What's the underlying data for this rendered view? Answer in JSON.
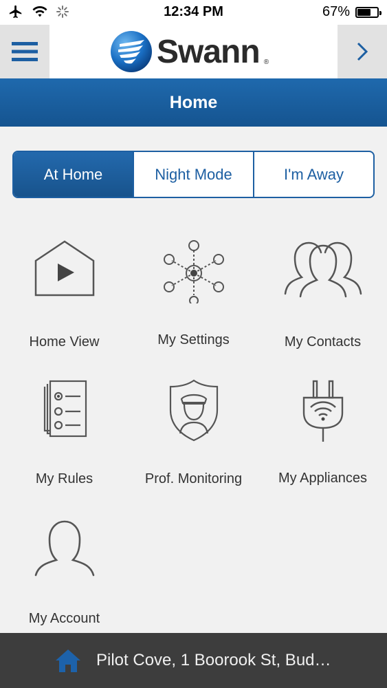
{
  "status_bar": {
    "time": "12:34 PM",
    "battery_percent": "67%",
    "battery_level": 0.67,
    "icons": [
      "airplane-icon",
      "wifi-icon",
      "loading-spinner-icon",
      "battery-icon"
    ]
  },
  "header": {
    "logo_text": "Swann",
    "logo_reg": "®",
    "menu_icon": "hamburger-menu-icon",
    "next_icon": "chevron-right-icon"
  },
  "title": "Home",
  "modes": {
    "items": [
      "At Home",
      "Night Mode",
      "I'm Away"
    ],
    "selected": "At Home"
  },
  "tiles": [
    {
      "label": "Home View",
      "icon": "house-play-icon"
    },
    {
      "label": "My Settings",
      "icon": "network-nodes-icon"
    },
    {
      "label": "My Contacts",
      "icon": "people-icon"
    },
    {
      "label": "My Rules",
      "icon": "checklist-icon"
    },
    {
      "label": "Prof. Monitoring",
      "icon": "guard-shield-icon"
    },
    {
      "label": "My Appliances",
      "icon": "wifi-plug-icon"
    },
    {
      "label": "My Account",
      "icon": "person-icon"
    }
  ],
  "bottom_bar": {
    "location": "Pilot Cove, 1 Boorook St, Bud…",
    "icon": "home-icon"
  },
  "colors": {
    "brand_blue": "#1d5fa2",
    "background": "#f1f1f1",
    "bottom_bar": "#3d3d3d"
  }
}
